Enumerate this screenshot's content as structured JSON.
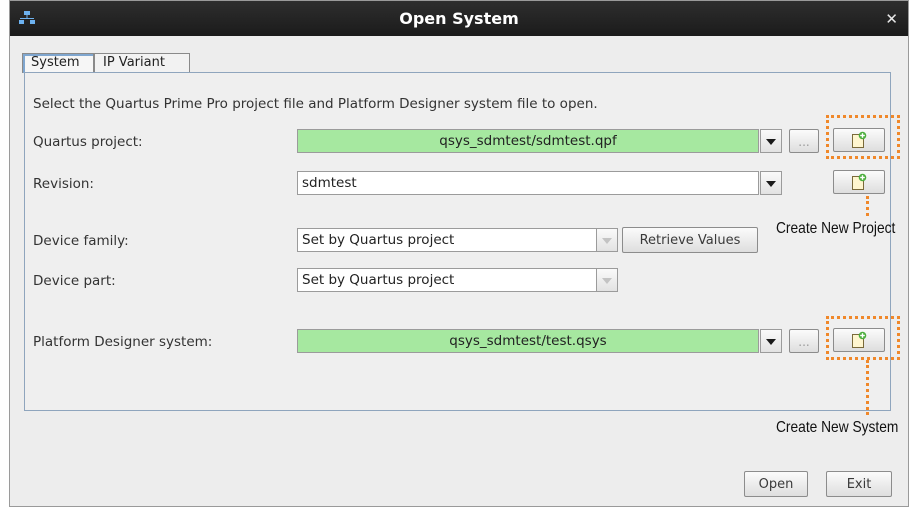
{
  "window": {
    "title": "Open System"
  },
  "tabs": [
    {
      "label": "System",
      "active": true
    },
    {
      "label": "IP Variant",
      "active": false
    }
  ],
  "instruction": "Select the Quartus Prime Pro project file and Platform Designer system file to open.",
  "fields": {
    "quartus_project": {
      "label": "Quartus project:",
      "value": "qsys_sdmtest/sdmtest.qpf"
    },
    "revision": {
      "label": "Revision:",
      "value": "sdmtest"
    },
    "device_family": {
      "label": "Device family:",
      "value": "Set by Quartus project"
    },
    "device_part": {
      "label": "Device part:",
      "value": "Set by Quartus project"
    },
    "platform_designer_system": {
      "label": "Platform Designer system:",
      "value": "qsys_sdmtest/test.qsys"
    }
  },
  "buttons": {
    "browse": "...",
    "retrieve": "Retrieve Values",
    "open": "Open",
    "exit": "Exit"
  },
  "callouts": {
    "new_project": "Create New Project",
    "new_system": "Create New System"
  },
  "colors": {
    "green_field": "#a6e8a0",
    "callout_orange": "#f0882a",
    "titlebar": "#1f1f1f",
    "panel_border": "#8fa5bd"
  },
  "icons": [
    "app-icon",
    "close-icon",
    "dropdown-arrow-icon",
    "new-file-icon"
  ]
}
